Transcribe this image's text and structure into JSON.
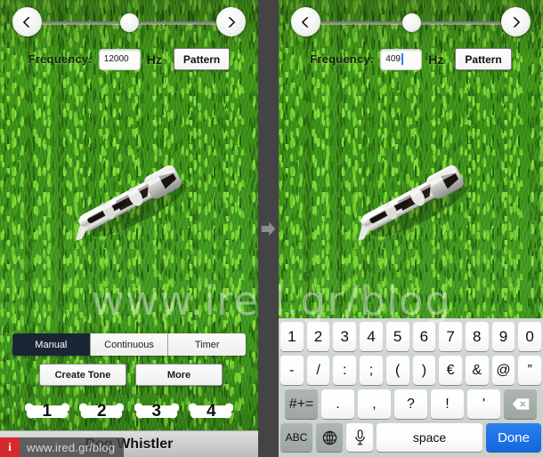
{
  "app": {
    "title": "Dog Whistler"
  },
  "credit": {
    "badge": "i",
    "url": "www.ired.gr/blog"
  },
  "watermark": {
    "text": "www.ired.gr/blog"
  },
  "separator": {
    "icon": "arrow-right-icon"
  },
  "panels": {
    "left": {
      "nav": {
        "prev_icon": "chevron-left-icon",
        "next_icon": "chevron-right-icon"
      },
      "slider": {
        "position_percent": 50
      },
      "frequency": {
        "label": "Frequency:",
        "value": "12000",
        "placeholder": "12000",
        "unit": "Hz",
        "caret_visible": false,
        "pattern_button": "Pattern"
      },
      "whistle": {
        "icon": "dog-whistle-image"
      },
      "modes": [
        {
          "label": "Manual",
          "active": true
        },
        {
          "label": "Continuous",
          "active": false
        },
        {
          "label": "Timer",
          "active": false
        }
      ],
      "actions": [
        {
          "label": "Create Tone"
        },
        {
          "label": "More"
        }
      ],
      "presets": [
        {
          "label": "1",
          "icon": "bone-icon"
        },
        {
          "label": "2",
          "icon": "bone-icon"
        },
        {
          "label": "3",
          "icon": "bone-icon"
        },
        {
          "label": "4",
          "icon": "bone-icon"
        }
      ]
    },
    "right": {
      "nav": {
        "prev_icon": "chevron-left-icon",
        "next_icon": "chevron-right-icon"
      },
      "slider": {
        "position_percent": 50
      },
      "frequency": {
        "label": "Frequency:",
        "value": "409",
        "placeholder": "409",
        "unit": "Hz",
        "caret_visible": true,
        "pattern_button": "Pattern"
      },
      "whistle": {
        "icon": "dog-whistle-image"
      },
      "keyboard": {
        "row1": [
          "1",
          "2",
          "3",
          "4",
          "5",
          "6",
          "7",
          "8",
          "9",
          "0"
        ],
        "row2": [
          "-",
          "/",
          ":",
          ";",
          "(",
          ")",
          "€",
          "&",
          "@",
          "”"
        ],
        "row3_symbol_key": "#+=",
        "row3": [
          ".",
          ",",
          "?",
          "!",
          "'"
        ],
        "row3_delete_icon": "backspace-icon",
        "row4": {
          "abc": "ABC",
          "globe_icon": "globe-icon",
          "mic_icon": "microphone-icon",
          "space": "space",
          "done": "Done"
        }
      }
    }
  },
  "colors": {
    "accent_blue": "#1b72e8",
    "tab_active": "#1a2535",
    "credit_red": "#d8282f",
    "grass_green": "#3f8d20",
    "separator_gray": "#444444"
  }
}
